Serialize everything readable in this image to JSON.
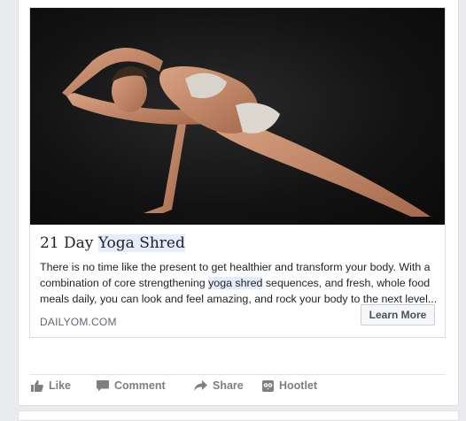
{
  "card": {
    "title_prefix": "21 Day ",
    "title_highlight": "Yoga Shred",
    "description_lines": [
      {
        "pre": "There is no time like the present to get healthier and transform your body. With a",
        "hl": "",
        "post": ""
      },
      {
        "pre": "combination of core strengthening ",
        "hl": "yoga shred",
        "post": " sequences, and fresh, whole food"
      },
      {
        "pre": "meals daily, you can look and feel amazing, and rock your body to the next level...",
        "hl": "",
        "post": ""
      }
    ],
    "domain": "DAILYOM.COM",
    "cta_label": "Learn More",
    "image_alt": "woman-in-yoga-pose-photo"
  },
  "actions": {
    "like": "Like",
    "comment": "Comment",
    "share": "Share",
    "hootlet": "Hootlet"
  },
  "colors": {
    "page_bg": "#e9ebee",
    "highlight": "#e7edf8",
    "action_text": "#7f7f7f"
  },
  "icons": {
    "like": "thumbs-up-icon",
    "comment": "speech-bubble-icon",
    "share": "share-arrow-icon",
    "hootlet": "hootlet-owl-icon"
  }
}
